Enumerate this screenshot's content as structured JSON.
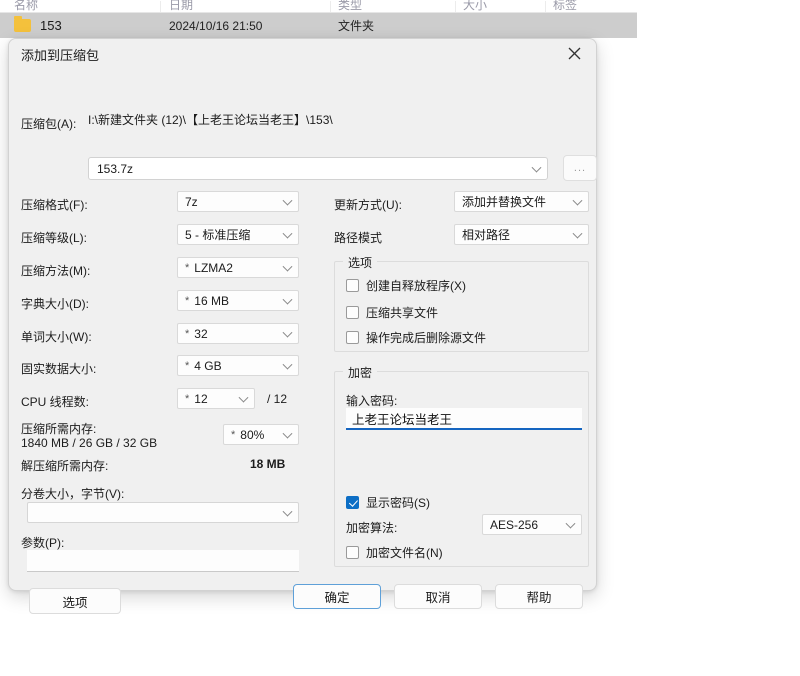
{
  "explorer": {
    "columns": [
      "名称",
      "日期",
      "类型",
      "大小",
      "标签"
    ],
    "row": {
      "name": "153",
      "date": "2024/10/16 21:50",
      "type": "文件夹"
    }
  },
  "dialog": {
    "title": "添加到压缩包",
    "close_icon": "close-icon",
    "archive": {
      "label": "压缩包(A):",
      "path": "I:\\新建文件夹 (12)\\【上老王论坛当老王】\\153\\",
      "value": "153.7z",
      "browse_label": "..."
    },
    "left": {
      "format_label": "压缩格式(F):",
      "format_value": "7z",
      "level_label": "压缩等级(L):",
      "level_value": "5 - 标准压缩",
      "method_label": "压缩方法(M):",
      "method_value": "LZMA2",
      "dict_label": "字典大小(D):",
      "dict_value": "16 MB",
      "word_label": "单词大小(W):",
      "word_value": "32",
      "solid_label": "固实数据大小:",
      "solid_value": "4 GB",
      "threads_label": "CPU 线程数:",
      "threads_value": "12",
      "threads_total": "/ 12",
      "mem_compress_label": "压缩所需内存:",
      "mem_compress_detail": "1840 MB / 26 GB / 32 GB",
      "mem_percent_value": "80%",
      "mem_decompress_label": "解压缩所需内存:",
      "mem_decompress_value": "18 MB",
      "split_label": "分卷大小，字节(V):",
      "split_value": "",
      "params_label": "参数(P):",
      "params_value": "",
      "options_button": "选项",
      "star": "*"
    },
    "right": {
      "update_label": "更新方式(U):",
      "update_value": "添加并替换文件",
      "path_mode_label": "路径模式",
      "path_mode_value": "相对路径",
      "options_group_title": "选项",
      "options": [
        {
          "label": "创建自释放程序(X)",
          "checked": false
        },
        {
          "label": "压缩共享文件",
          "checked": false
        },
        {
          "label": "操作完成后删除源文件",
          "checked": false
        }
      ],
      "encrypt_group_title": "加密",
      "password_label": "输入密码:",
      "password_value": "上老王论坛当老王",
      "show_password": {
        "label": "显示密码(S)",
        "checked": true
      },
      "algo_label": "加密算法:",
      "algo_value": "AES-256",
      "encrypt_names": {
        "label": "加密文件名(N)",
        "checked": false
      }
    },
    "buttons": {
      "ok": "确定",
      "cancel": "取消",
      "help": "帮助"
    }
  },
  "colors": {
    "accent": "#0d6ec5",
    "dialog_bg": "#f0f0f0",
    "row_selected": "#cdcdcd",
    "folder": "#f4c13c",
    "focus_border": "#5ea0d8"
  }
}
